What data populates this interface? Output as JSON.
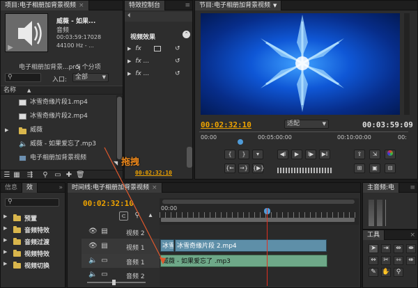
{
  "project": {
    "tab": "项目:电子相册加背景视频",
    "clip_name": "威薇 - 如果...",
    "clip_type": "音频",
    "clip_duration": "00:03:59:17028",
    "clip_rate": "44100 Hz - ...",
    "project_file": "电子相册加背景...proj",
    "item_count": "5 个分项",
    "entry_label": "入口:",
    "entry_value": "全部",
    "col_name": "名称",
    "items": [
      {
        "name": "冰雪奇缘片段1.mp4",
        "icon": "video-file-icon"
      },
      {
        "name": "冰雪奇缘片段2.mp4",
        "icon": "video-file-icon"
      },
      {
        "name": "威薇",
        "icon": "folder-icon"
      },
      {
        "name": "威薇 - 如果爱忘了.mp3",
        "icon": "audio-file-icon"
      },
      {
        "name": "电子相册加背景视频",
        "icon": "sequence-icon"
      }
    ]
  },
  "effects": {
    "tab": "特效控制台",
    "section": "视频效果",
    "rows": [
      "fx",
      "fx ...",
      "fx ..."
    ]
  },
  "program": {
    "tab": "节目:电子相册加背景视频",
    "timecode": "00:02:32:10",
    "fit": "适配",
    "duration": "00:03:59:09",
    "ruler": [
      "00:00",
      "00:05:00:00",
      "00:10:00:00",
      "00:"
    ]
  },
  "annotation": {
    "drag_label": "拖拽",
    "small_timecode": "00:02:32:10"
  },
  "info": {
    "tabs": [
      "信息",
      "效"
    ],
    "folders": [
      "预置",
      "音频特效",
      "音频过渡",
      "视频特效",
      "视频切换"
    ]
  },
  "timeline": {
    "tab": "时间线:电子相册加背景视频",
    "timecode": "00:02:32:10",
    "ruler_start": "00:00",
    "tracks": [
      {
        "name": "视频 2"
      },
      {
        "name": "视频 1"
      },
      {
        "name": "音频 1"
      },
      {
        "name": "音频 2"
      }
    ],
    "video_clip_short": "冰雪",
    "video_clip": "冰雪奇缘片段 2.mp4",
    "audio_clip": "威薇 - 如果爱忘了 .mp3"
  },
  "master": {
    "tab": "主音频:电"
  },
  "tools": {
    "tab": "工具"
  },
  "colors": {
    "accent": "#f0a400",
    "video_clip": "#5e8fa8",
    "audio_clip": "#6ea888",
    "drag_arrow": "#e0582c"
  }
}
